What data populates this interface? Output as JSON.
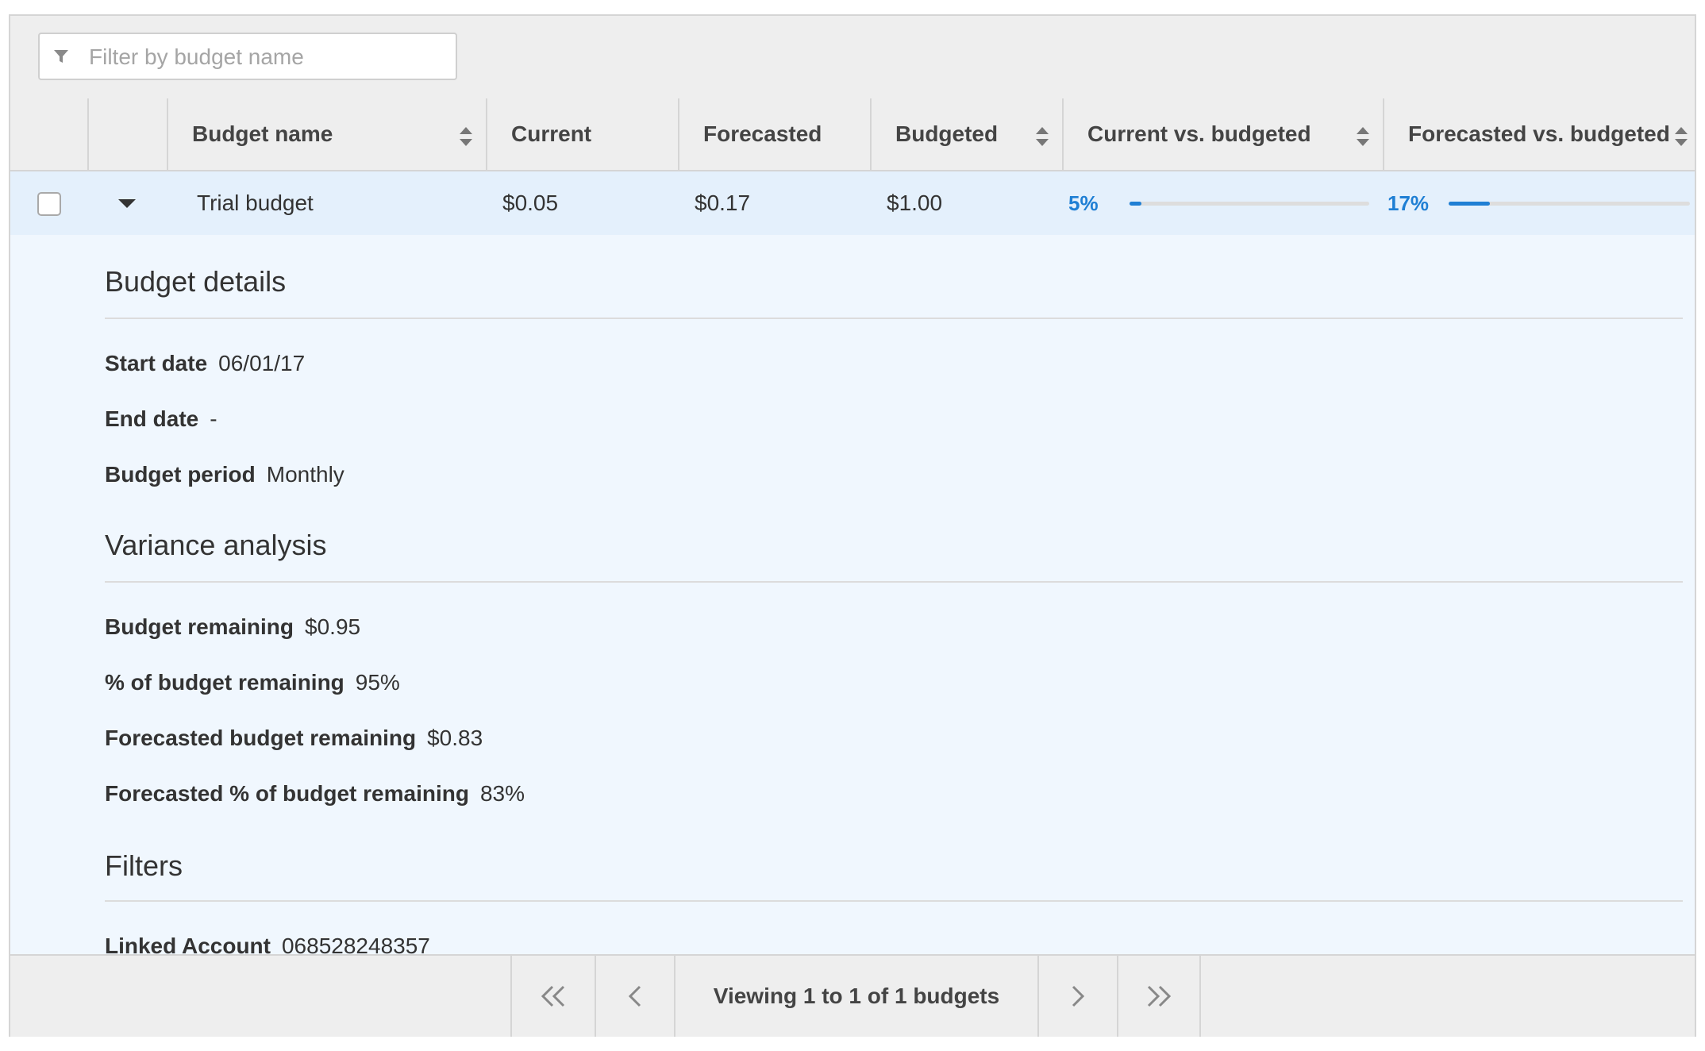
{
  "filter": {
    "placeholder": "Filter by budget name"
  },
  "columns": [
    "Budget name",
    "Current",
    "Forecasted",
    "Budgeted",
    "Current vs. budgeted",
    "Forecasted vs. budgeted"
  ],
  "row": {
    "name": "Trial budget",
    "current": "$0.05",
    "forecasted": "$0.17",
    "budgeted": "$1.00",
    "current_vs_budgeted": "5%",
    "current_vs_budgeted_value": 0.05,
    "forecasted_vs_budgeted": "17%",
    "forecasted_vs_budgeted_value": 0.17
  },
  "details": {
    "budget_details": {
      "title": "Budget details",
      "start_date_label": "Start date",
      "start_date": "06/01/17",
      "end_date_label": "End date",
      "end_date": "-",
      "period_label": "Budget period",
      "period": "Monthly"
    },
    "variance": {
      "title": "Variance analysis",
      "remaining_label": "Budget remaining",
      "remaining": "$0.95",
      "pct_remaining_label": "% of budget remaining",
      "pct_remaining": "95%",
      "fc_remaining_label": "Forecasted budget remaining",
      "fc_remaining": "$0.83",
      "fc_pct_remaining_label": "Forecasted % of budget remaining",
      "fc_pct_remaining": "83%"
    },
    "filters": {
      "title": "Filters",
      "linked_account_label": "Linked Account",
      "linked_account": "068528248357"
    }
  },
  "pagination": {
    "text": "Viewing 1 to 1 of 1 budgets"
  },
  "colors": {
    "accent": "#1f7fd4",
    "row_selected": "#e4f0fc",
    "details_bg": "#f0f7fe",
    "header_bg": "#eeeeee"
  }
}
